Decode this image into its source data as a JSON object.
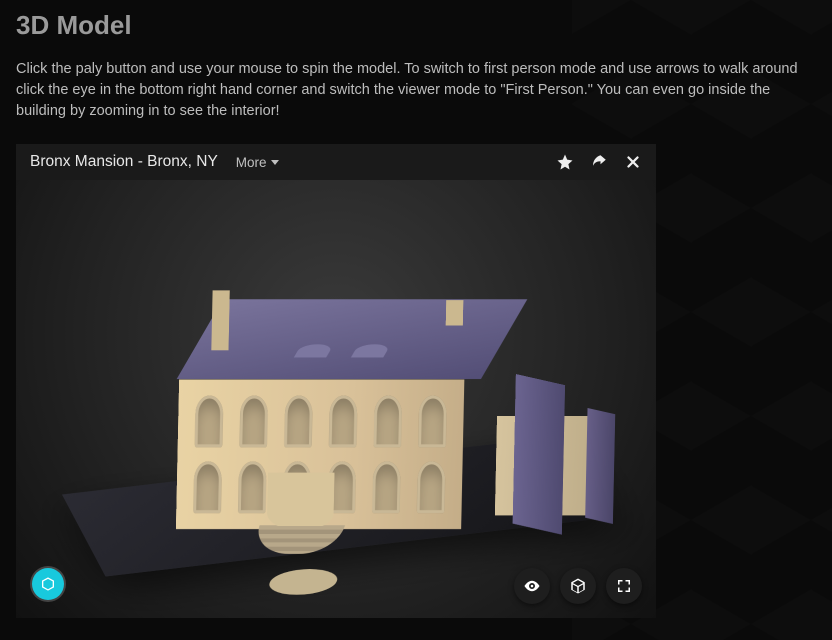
{
  "section": {
    "heading": "3D Model",
    "description": "Click the paly button and use your mouse to spin the model. To switch to first person mode and use arrows to walk around click the eye in the bottom right hand corner and switch the viewer mode to \"First Person.\" You can even go inside the building by zooming in to see the interior!"
  },
  "viewer": {
    "title": "Bronx Mansion - Bronx, NY",
    "more_label": "More",
    "header_icons": {
      "favorite": "star-icon",
      "share": "share-icon",
      "close": "close-icon"
    },
    "bottom_icons": {
      "view_mode": "eye-icon",
      "ar_vr": "cube-icon",
      "fullscreen": "fullscreen-icon"
    },
    "brand_icon": "sketchfab-cube-icon"
  },
  "colors": {
    "accent": "#18c9dd",
    "model_warm": "#e0cda0",
    "model_cool": "#6a6390",
    "page_bg": "#0a0a0a"
  }
}
